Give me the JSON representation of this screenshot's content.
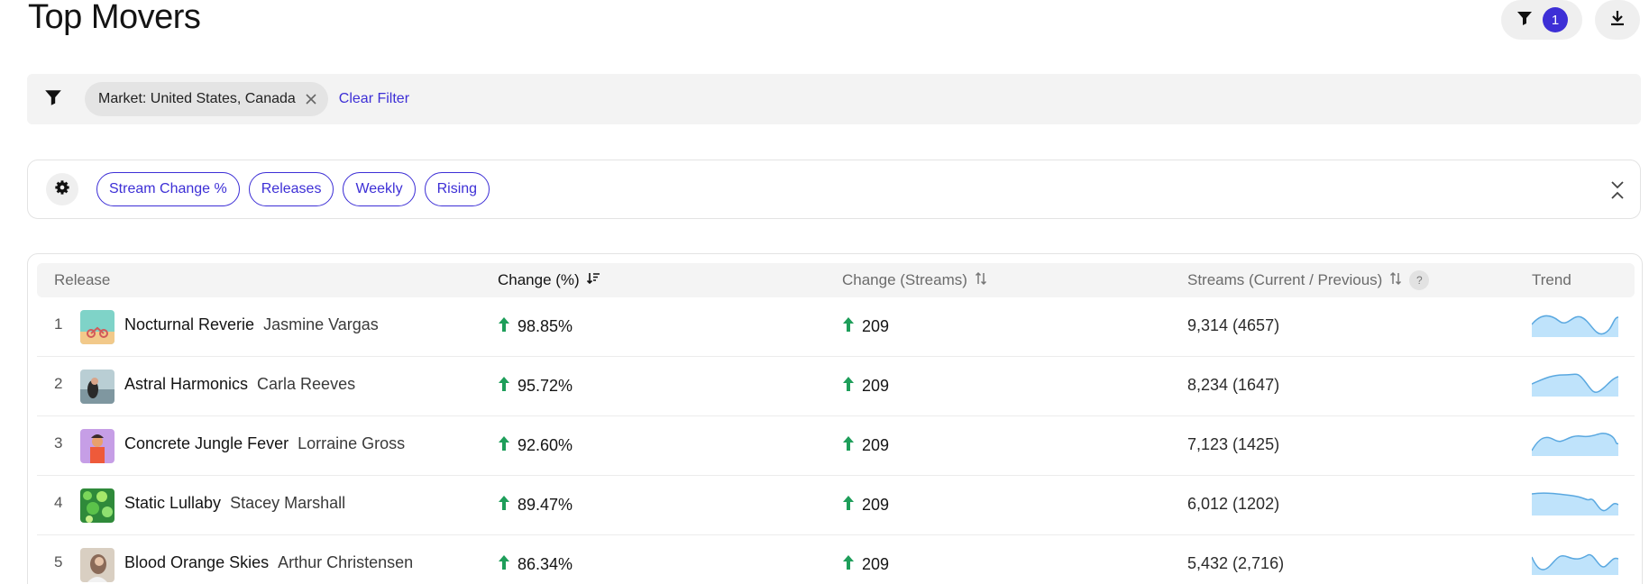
{
  "page": {
    "title": "Top Movers"
  },
  "header_actions": {
    "filter_count": "1"
  },
  "filters": {
    "chip_label": "Market: United States, Canada",
    "clear_label": "Clear Filter"
  },
  "view_tags": [
    "Stream Change %",
    "Releases",
    "Weekly",
    "Rising"
  ],
  "table": {
    "columns": {
      "release": "Release",
      "change_pct": "Change (%)",
      "change_streams": "Change (Streams)",
      "streams": "Streams (Current / Previous)",
      "trend": "Trend"
    },
    "help_glyph": "?",
    "rows": [
      {
        "rank": "1",
        "title": "Nocturnal Reverie",
        "artist": "Jasmine Vargas",
        "change_pct": "98.85%",
        "change_streams": "209",
        "streams": "9,314 (4657)"
      },
      {
        "rank": "2",
        "title": "Astral Harmonics",
        "artist": "Carla Reeves",
        "change_pct": "95.72%",
        "change_streams": "209",
        "streams": "8,234 (1647)"
      },
      {
        "rank": "3",
        "title": "Concrete Jungle Fever",
        "artist": "Lorraine Gross",
        "change_pct": "92.60%",
        "change_streams": "209",
        "streams": "7,123 (1425)"
      },
      {
        "rank": "4",
        "title": "Static Lullaby",
        "artist": "Stacey Marshall",
        "change_pct": "89.47%",
        "change_streams": "209",
        "streams": "6,012 (1202)"
      },
      {
        "rank": "5",
        "title": "Blood Orange Skies",
        "artist": "Arthur Christensen",
        "change_pct": "86.34%",
        "change_streams": "209",
        "streams": "5,432 (2,716)"
      }
    ]
  },
  "colors": {
    "accent": "#3d2fd6",
    "up_arrow": "#1e9e5a",
    "sparkline_fill": "#bfe3fb",
    "sparkline_stroke": "#5aa8e0"
  }
}
